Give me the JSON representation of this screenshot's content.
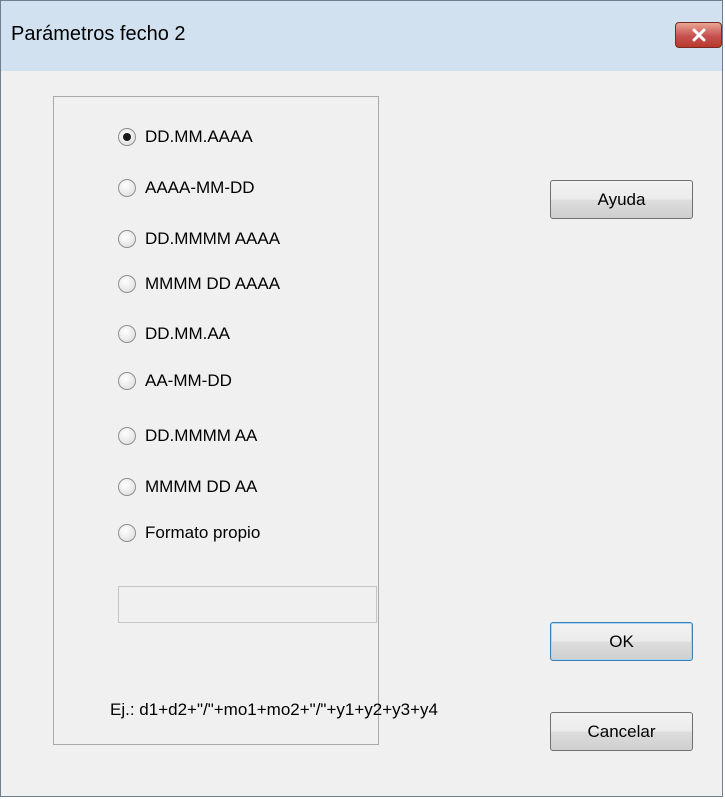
{
  "dialog": {
    "title": "Parámetros fecho 2"
  },
  "formats": [
    {
      "label": "DD.MM.AAAA",
      "checked": true
    },
    {
      "label": "AAAA-MM-DD",
      "checked": false
    },
    {
      "label": "DD.MMMM AAAA",
      "checked": false
    },
    {
      "label": "MMMM DD AAAA",
      "checked": false
    },
    {
      "label": "DD.MM.AA",
      "checked": false
    },
    {
      "label": "AA-MM-DD",
      "checked": false
    },
    {
      "label": "DD.MMMM AA",
      "checked": false
    },
    {
      "label": "MMMM DD AA",
      "checked": false
    },
    {
      "label": "Formato propio",
      "checked": false
    }
  ],
  "custom_format": {
    "value": ""
  },
  "example_text": "Ej.: d1+d2+\"/\"+mo1+mo2+\"/\"+y1+y2+y3+y4",
  "buttons": {
    "help": "Ayuda",
    "ok": "OK",
    "cancel": "Cancelar"
  },
  "colors": {
    "titlebar": "#d2e1f0",
    "close_button": "#c75050",
    "dialog_background": "#f0f0f0"
  }
}
